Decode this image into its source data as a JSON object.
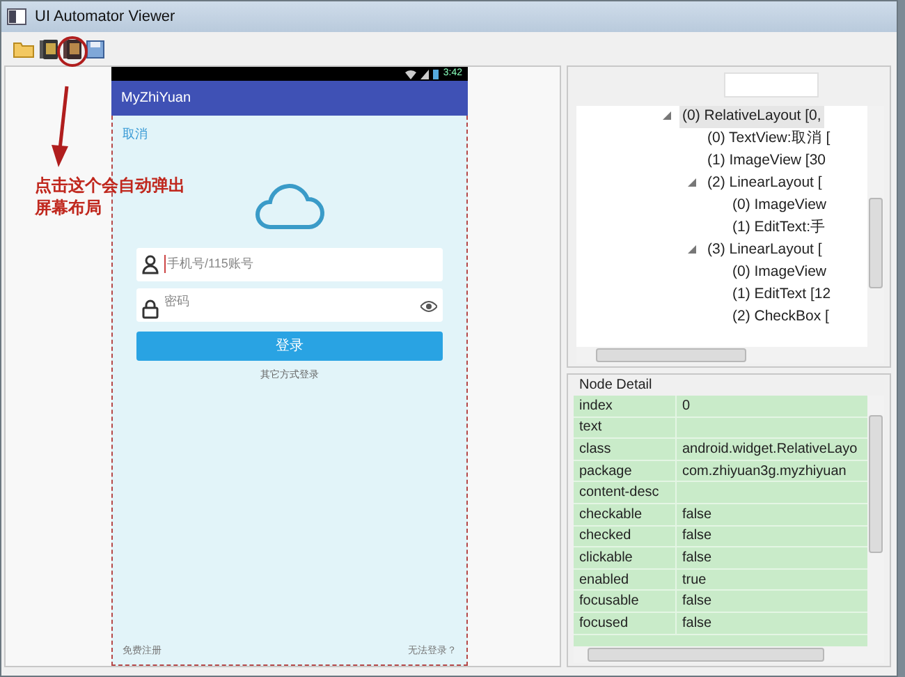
{
  "window": {
    "title": "UI Automator Viewer"
  },
  "annotation": {
    "lines": [
      "点击这个会自动弹出",
      "屏幕布局"
    ]
  },
  "device": {
    "status_time": "3:42",
    "app_title": "MyZhiYuan",
    "cancel": "取消",
    "phone_placeholder": "手机号/115账号",
    "password_placeholder": "密码",
    "login_button": "登录",
    "other_login": "其它方式登录",
    "register": "免费注册",
    "cant_login": "无法登录？"
  },
  "tree": {
    "nodes": [
      {
        "label": "(0) RelativeLayout [0,",
        "expanded": true,
        "selected": true,
        "children": [
          {
            "label": "(0) TextView:取消 [",
            "selected": false
          },
          {
            "label": "(1) ImageView [30",
            "selected": false
          },
          {
            "label": "(2) LinearLayout [",
            "expanded": true,
            "selected": false,
            "children": [
              {
                "label": "(0) ImageView",
                "selected": false
              },
              {
                "label": "(1) EditText:手",
                "selected": false
              }
            ]
          },
          {
            "label": "(3) LinearLayout [",
            "expanded": true,
            "selected": false,
            "children": [
              {
                "label": "(0) ImageView",
                "selected": false
              },
              {
                "label": "(1) EditText [12",
                "selected": false
              },
              {
                "label": "(2) CheckBox [",
                "selected": false
              }
            ]
          }
        ]
      }
    ]
  },
  "node_detail": {
    "title": "Node Detail",
    "rows": [
      {
        "key": "index",
        "value": "0"
      },
      {
        "key": "text"
      },
      {
        "key": "class",
        "value": "android.widget.RelativeLayo"
      },
      {
        "key": "package",
        "value": "com.zhiyuan3g.myzhiyuan"
      },
      {
        "key": "content-desc"
      },
      {
        "key": "checkable",
        "value": "false"
      },
      {
        "key": "checked",
        "value": "false"
      },
      {
        "key": "clickable",
        "value": "false"
      },
      {
        "key": "enabled",
        "value": "true"
      },
      {
        "key": "focusable",
        "value": "false"
      },
      {
        "key": "focused",
        "value": "false"
      }
    ]
  }
}
